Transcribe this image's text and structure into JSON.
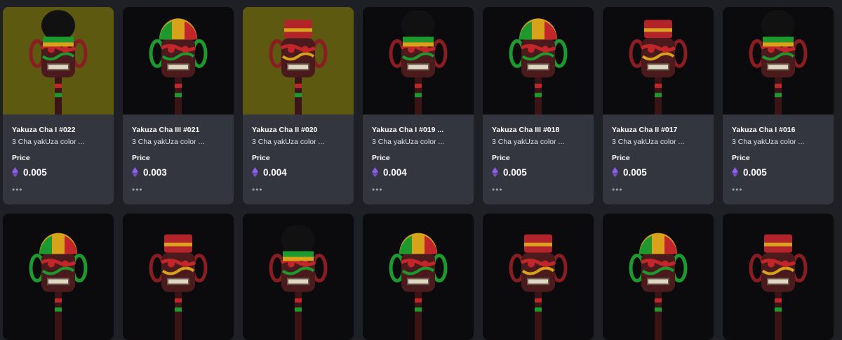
{
  "labels": {
    "price": "Price",
    "more": "•••"
  },
  "colors": {
    "olive_bg": "#5e5910",
    "dark_bg": "#0b0b0d",
    "card": "#33363f",
    "page": "#1f2026",
    "eth": "#8e5cf0"
  },
  "row1": [
    {
      "title": "Yakuza Cha I #022",
      "desc": "3 Cha yakUza color ...",
      "price": "0.005",
      "bg": "olive",
      "head": "black"
    },
    {
      "title": "Yakuza Cha III #021",
      "desc": "3 Cha yakUza color ...",
      "price": "0.003",
      "bg": "dark",
      "head": "rasta"
    },
    {
      "title": "Yakuza Cha II #020",
      "desc": "3 Cha yakUza color ...",
      "price": "0.004",
      "bg": "olive",
      "head": "red"
    },
    {
      "title": "Yakuza Cha I #019 ...",
      "desc": "3 Cha yakUza color ...",
      "price": "0.004",
      "bg": "dark",
      "head": "black"
    },
    {
      "title": "Yakuza Cha III #018",
      "desc": "3 Cha yakUza color ...",
      "price": "0.005",
      "bg": "dark",
      "head": "rasta"
    },
    {
      "title": "Yakuza Cha II #017",
      "desc": "3 Cha yakUza color ...",
      "price": "0.005",
      "bg": "dark",
      "head": "red"
    },
    {
      "title": "Yakuza Cha I #016",
      "desc": "3 Cha yakUza color ...",
      "price": "0.005",
      "bg": "dark",
      "head": "black"
    }
  ],
  "row2": [
    {
      "bg": "dark",
      "head": "rasta"
    },
    {
      "bg": "dark",
      "head": "red"
    },
    {
      "bg": "dark",
      "head": "black"
    },
    {
      "bg": "dark",
      "head": "rasta"
    },
    {
      "bg": "dark",
      "head": "red"
    },
    {
      "bg": "dark",
      "head": "rasta"
    },
    {
      "bg": "dark",
      "head": "red"
    }
  ]
}
